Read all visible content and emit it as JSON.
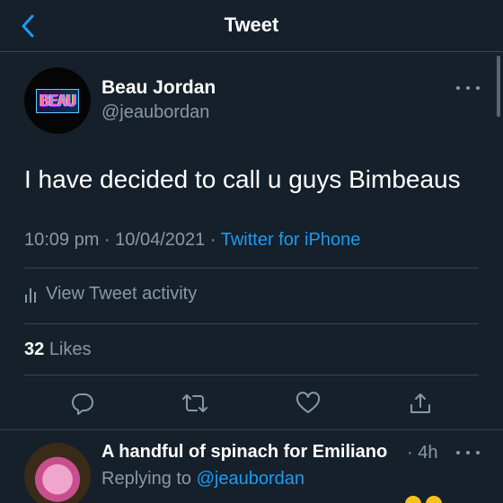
{
  "nav": {
    "title": "Tweet",
    "back_icon": "chevron-left-icon"
  },
  "tweet": {
    "author_name": "Beau Jordan",
    "author_handle": "@jeaubordan",
    "avatar_logo_text": "BEAU",
    "text": "I have decided to call u guys Bimbeaus",
    "time": "10:09 pm",
    "date": "10/04/2021",
    "source": "Twitter for iPhone",
    "separator": " · ",
    "activity_label": "View Tweet activity",
    "likes_count": "32",
    "likes_label": "Likes"
  },
  "actions": [
    {
      "name": "reply",
      "icon": "reply-icon"
    },
    {
      "name": "retweet",
      "icon": "retweet-icon"
    },
    {
      "name": "like",
      "icon": "heart-icon"
    },
    {
      "name": "share",
      "icon": "share-icon"
    }
  ],
  "reply": {
    "author_name": "A handful of spinach for Emiliano",
    "time": "4h",
    "replying_label": "Replying to",
    "replying_handle": "@jeaubordan"
  },
  "colors": {
    "background": "#15202b",
    "text": "#ffffff",
    "muted": "#8899a6",
    "accent": "#1d9bf0",
    "divider": "#38444d"
  }
}
